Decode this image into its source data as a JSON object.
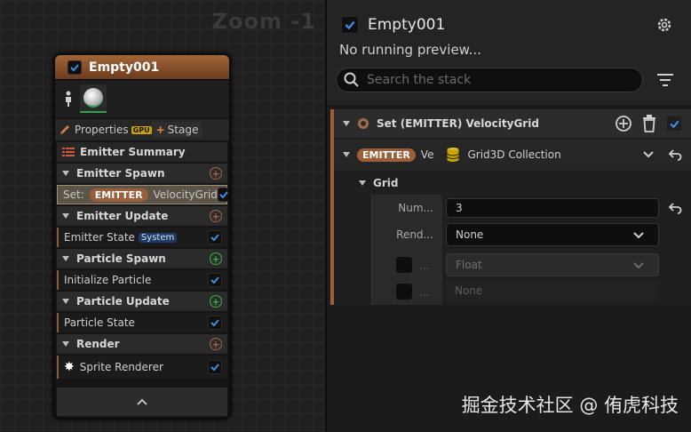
{
  "graph": {
    "zoom_label": "Zoom -1",
    "node": {
      "title": "Empty001",
      "properties_label": "Properties",
      "gpu_badge": "GPU",
      "stage_label": "Stage",
      "summary_label": "Emitter Summary",
      "sections": [
        {
          "label": "Emitter Spawn",
          "plus_color": "orange"
        },
        {
          "label": "Emitter Update",
          "plus_color": "orange"
        },
        {
          "label": "Particle Spawn",
          "plus_color": "green"
        },
        {
          "label": "Particle Update",
          "plus_color": "green"
        },
        {
          "label": "Render",
          "plus_color": "orange"
        }
      ],
      "set_prefix": "Set:",
      "set_badge": "EMITTER",
      "set_target": "VelocityGrid",
      "emitter_state": "Emitter State",
      "system_badge": "System",
      "initialize_particle": "Initialize Particle",
      "particle_state": "Particle State",
      "sprite_renderer": "Sprite Renderer"
    }
  },
  "panel": {
    "title": "Empty001",
    "preview_text": "No running preview...",
    "search_placeholder": "Search the stack",
    "module_title": "Set (EMITTER) VelocityGrid",
    "param_badge": "EMITTER",
    "param_trunc": "Ve",
    "param_type": "Grid3D Collection",
    "group_label": "Grid",
    "num_label": "Num...",
    "num_value": "3",
    "rend_label": "Rend...",
    "rend_value": "None",
    "float_label": "...",
    "float_value": "Float",
    "none_label": "...",
    "none_value": "None"
  },
  "watermark": "掘金技术社区 @ 侑虎科技",
  "colors": {
    "accent_orange": "#9a5f3a",
    "check_blue": "#2d7fd6",
    "plus_green": "#3fae4a"
  }
}
